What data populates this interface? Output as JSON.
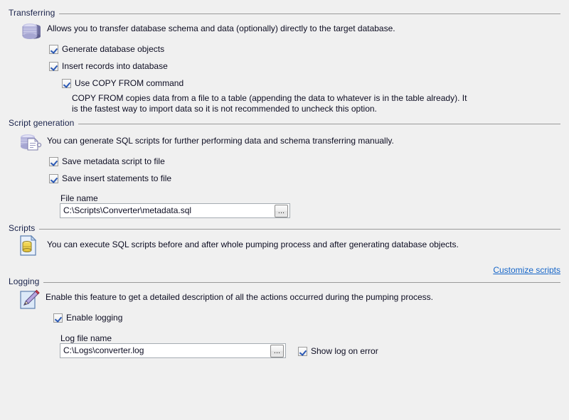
{
  "sections": {
    "transferring": {
      "title": "Transferring",
      "icon": "database-stack-icon",
      "description": "Allows you to transfer database schema and data (optionally) directly to the target database.",
      "options": [
        {
          "label": "Generate database objects",
          "checked": true,
          "name": "generate-database-objects"
        },
        {
          "label": "Insert records into database",
          "checked": true,
          "name": "insert-records-into-database"
        },
        {
          "label": "Use COPY FROM command",
          "checked": true,
          "name": "use-copy-from-command"
        }
      ],
      "hint_line1": "COPY FROM copies data from a file to a table (appending the data to whatever is in the table already). It",
      "hint_line2": "is the fastest way to import data so it is not recommended to uncheck this option."
    },
    "script_generation": {
      "title": "Script generation",
      "icon": "database-script-icon",
      "description": "You can generate SQL scripts for further performing data and schema transferring manually.",
      "options": [
        {
          "label": "Save metadata script to file",
          "checked": true,
          "name": "save-metadata-script-to-file"
        },
        {
          "label": "Save insert statements to file",
          "checked": true,
          "name": "save-insert-statements-to-file"
        }
      ],
      "file_name_label": "File name",
      "file_name_value": "C:\\Scripts\\Converter\\metadata.sql",
      "browse_label": "...",
      "browse_icon": "ellipsis-browse-icon"
    },
    "scripts": {
      "title": "Scripts",
      "icon": "script-page-icon",
      "description": "You can execute SQL scripts before and after whole pumping process and after generating database objects.",
      "customize_link": "Customize scripts"
    },
    "logging": {
      "title": "Logging",
      "icon": "log-pencil-icon",
      "description": "Enable this feature to get a detailed description of all the actions occurred during the pumping process.",
      "options": [
        {
          "label": "Enable logging",
          "checked": true,
          "name": "enable-logging"
        },
        {
          "label": "Show log on error",
          "checked": true,
          "name": "show-log-on-error"
        }
      ],
      "log_file_label": "Log file name",
      "log_file_value": "C:\\Logs\\converter.log",
      "browse_label": "...",
      "browse_icon": "ellipsis-browse-icon"
    }
  },
  "colors": {
    "background": "#f0f0f0",
    "group_title": "#19224a",
    "text": "#0d0d22",
    "link": "#1565c8",
    "rule": "#9a9a9a",
    "checkmark": "#2a58b4",
    "field_border": "#a5acb2"
  }
}
